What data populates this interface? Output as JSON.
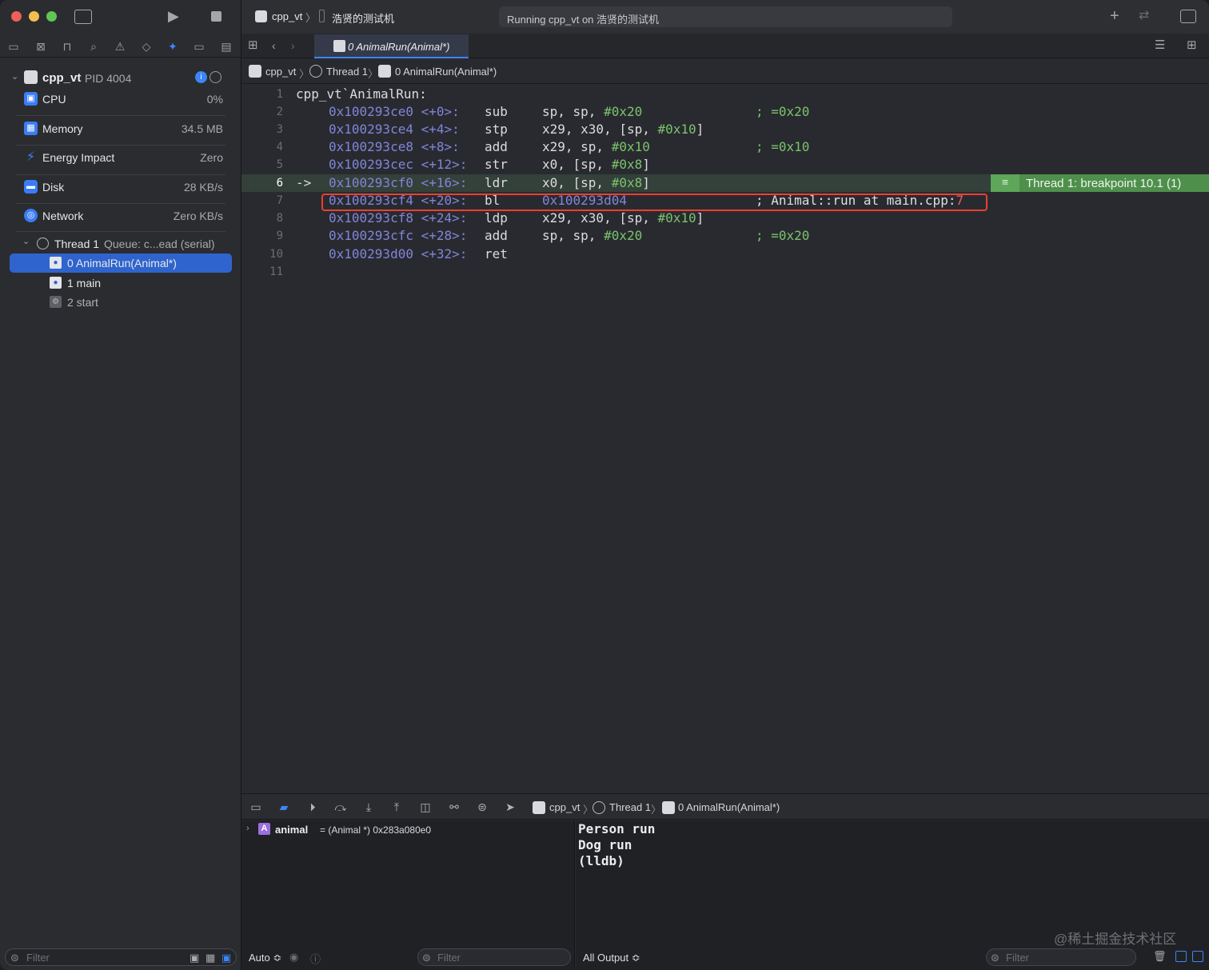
{
  "toolbar": {
    "scheme": "cpp_vt",
    "device": "浩贤的测试机",
    "activity": "Running cpp_vt on 浩贤的测试机"
  },
  "tab": {
    "label": "0 AnimalRun(Animal*)"
  },
  "breadcrumb": [
    "cpp_vt",
    "Thread 1",
    "0 AnimalRun(Animal*)"
  ],
  "process": {
    "name": "cpp_vt",
    "pid": "PID 4004"
  },
  "gauges": [
    {
      "label": "CPU",
      "value": "0%"
    },
    {
      "label": "Memory",
      "value": "34.5 MB"
    },
    {
      "label": "Energy Impact",
      "value": "Zero"
    },
    {
      "label": "Disk",
      "value": "28 KB/s"
    },
    {
      "label": "Network",
      "value": "Zero KB/s"
    }
  ],
  "thread": {
    "name": "Thread 1",
    "queue": "Queue: c...ead (serial)"
  },
  "frames": [
    {
      "label": "0 AnimalRun(Animal*)",
      "selected": true
    },
    {
      "label": "1 main",
      "selected": false
    },
    {
      "label": "2 start",
      "selected": false
    }
  ],
  "editor": {
    "lines": [
      {
        "num": "1",
        "label": "cpp_vt`AnimalRun:"
      },
      {
        "num": "2",
        "addr": "0x100293ce0",
        "off": "<+0>:",
        "op": "sub",
        "args": "sp, sp, ",
        "imm": "#0x20",
        "tail": "",
        "cmt": "; =0x20"
      },
      {
        "num": "3",
        "addr": "0x100293ce4",
        "off": "<+4>:",
        "op": "stp",
        "args": "x29, x30, [sp, ",
        "imm": "#0x10",
        "tail": "]",
        "cmt": ""
      },
      {
        "num": "4",
        "addr": "0x100293ce8",
        "off": "<+8>:",
        "op": "add",
        "args": "x29, sp, ",
        "imm": "#0x10",
        "tail": "",
        "cmt": "; =0x10"
      },
      {
        "num": "5",
        "addr": "0x100293cec",
        "off": "<+12>:",
        "op": "str",
        "args": "x0, [sp, ",
        "imm": "#0x8",
        "tail": "]",
        "cmt": ""
      },
      {
        "num": "6",
        "arrow": "->",
        "addr": "0x100293cf0",
        "off": "<+16>:",
        "op": "ldr",
        "args": "x0, [sp, ",
        "imm": "#0x8",
        "tail": "]",
        "cmt": ""
      },
      {
        "num": "7",
        "addr": "0x100293cf4",
        "off": "<+20>:",
        "op": "bl",
        "target": "0x100293d04",
        "cmt": "; Animal::run at main.cpp:",
        "cmtline": "7"
      },
      {
        "num": "8",
        "addr": "0x100293cf8",
        "off": "<+24>:",
        "op": "ldp",
        "args": "x29, x30, [sp, ",
        "imm": "#0x10",
        "tail": "]",
        "cmt": ""
      },
      {
        "num": "9",
        "addr": "0x100293cfc",
        "off": "<+28>:",
        "op": "add",
        "args": "sp, sp, ",
        "imm": "#0x20",
        "tail": "",
        "cmt": "; =0x20"
      },
      {
        "num": "10",
        "addr": "0x100293d00",
        "off": "<+32>:",
        "op": "ret",
        "args": "",
        "imm": "",
        "tail": "",
        "cmt": ""
      },
      {
        "num": "11"
      }
    ],
    "breakpoint_label": "Thread 1: breakpoint 10.1 (1)"
  },
  "variables": {
    "name": "animal",
    "value": "= (Animal *) 0x283a080e0"
  },
  "console": {
    "output": "Person run\nDog run\n(lldb)"
  },
  "bottombar": {
    "auto": "Auto ≎",
    "filter": "Filter",
    "all_output": "All Output ≎"
  },
  "nav_filter": "Filter",
  "watermark": "@稀土掘金技术社区"
}
